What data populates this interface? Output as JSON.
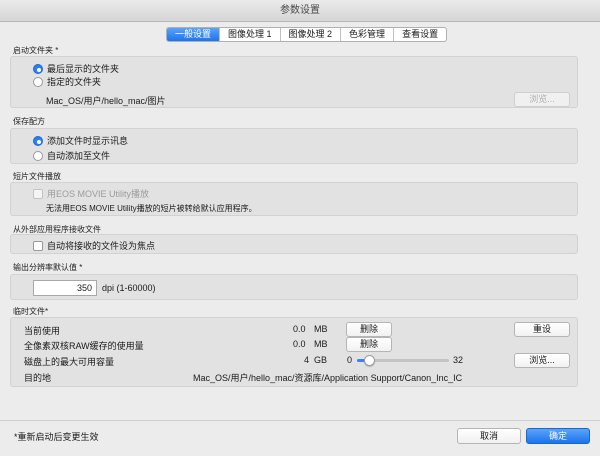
{
  "window": {
    "title": "参数设置"
  },
  "tabs": [
    {
      "label": "一般设置",
      "active": true
    },
    {
      "label": "图像处理 1",
      "active": false
    },
    {
      "label": "图像处理 2",
      "active": false
    },
    {
      "label": "色彩管理",
      "active": false
    },
    {
      "label": "查看设置",
      "active": false
    }
  ],
  "startup_folder": {
    "title": "启动文件夹 *",
    "options": [
      {
        "label": "最后显示的文件夹",
        "selected": true
      },
      {
        "label": "指定的文件夹",
        "selected": false
      }
    ],
    "path": "Mac_OS/用户/hello_mac/图片",
    "browse_label": "浏览..."
  },
  "save_rating": {
    "title": "保存配方",
    "options": [
      {
        "label": "添加文件时显示讯息",
        "selected": true
      },
      {
        "label": "自动添加至文件",
        "selected": false
      }
    ]
  },
  "short_movie": {
    "title": "短片文件播放",
    "checkbox_label": "用EOS MOVIE Utility播放",
    "note": "无法用EOS MOVIE Utility播放的短片被转给默认应用程序。"
  },
  "external_app": {
    "title": "从外部应用程序接收文件",
    "checkbox_label": "自动将接收的文件设为焦点"
  },
  "output_resolution": {
    "title": "输出分辨率默认值 *",
    "value": "350",
    "unit": "dpi (1-60000)"
  },
  "temp_files": {
    "title": "临时文件*",
    "rows": [
      {
        "label": "当前使用",
        "value": "0.0",
        "unit": "MB",
        "button": "删除"
      },
      {
        "label": "全像素双核RAW缓存的使用量",
        "value": "0.0",
        "unit": "MB",
        "button": "删除"
      }
    ],
    "reset_label": "重设",
    "max_label": "磁盘上的最大可用容量",
    "max_value": "4",
    "max_unit": "GB",
    "slider_min": "0",
    "slider_max": "32",
    "slider_fraction": 0.125,
    "browse_label": "浏览...",
    "dest_label": "目的地",
    "dest_path": "Mac_OS/用户/hello_mac/资源库/Application Support/Canon_Inc_IC"
  },
  "footer": {
    "note": "*重新启动后变更生效",
    "cancel_label": "取消",
    "ok_label": "确定"
  }
}
